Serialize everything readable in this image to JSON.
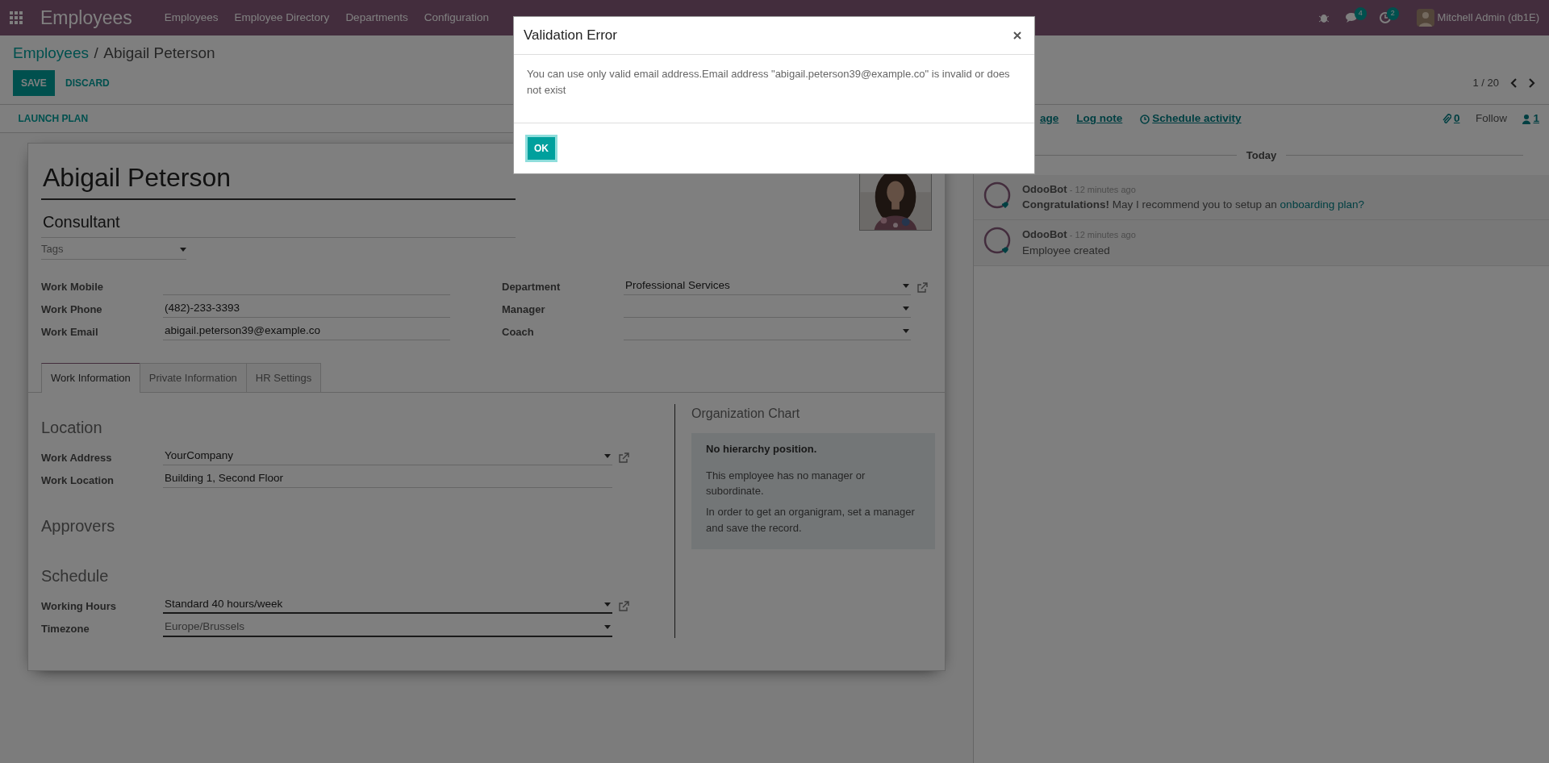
{
  "navbar": {
    "app_title": "Employees",
    "menu": [
      "Employees",
      "Employee Directory",
      "Departments",
      "Configuration"
    ],
    "messages_count": "4",
    "activities_count": "2",
    "user": "Mitchell Admin (db1E)"
  },
  "breadcrumb_separator": "/",
  "breadcrumb": [
    {
      "label": "Employees"
    },
    {
      "label": "Abigail Peterson"
    }
  ],
  "buttons": [
    {
      "label": "SAVE",
      "kind": "primary"
    },
    {
      "label": "DISCARD",
      "kind": "link"
    }
  ],
  "pager": "1 / 20",
  "status_buttons": [
    "LAUNCH PLAN"
  ],
  "form": {
    "name": "Abigail Peterson",
    "job_title": "Consultant",
    "tags_placeholder": "Tags",
    "groups": [
      [
        {
          "label": "Work Mobile",
          "kind": "text"
        },
        {
          "label": "Work Phone",
          "kind": "text",
          "value": "(482)-233-3393"
        },
        {
          "label": "Work Email",
          "kind": "text",
          "value": "abigail.peterson39@example.co"
        }
      ],
      [
        {
          "label": "Department",
          "kind": "many2one",
          "value": "Professional Services",
          "open_link": true
        },
        {
          "label": "Manager",
          "kind": "many2one",
          "open_link": false
        },
        {
          "label": "Coach",
          "kind": "many2one",
          "open_link": false
        }
      ]
    ],
    "tabs": [
      {
        "label": "Work Information",
        "selected": true
      },
      {
        "label": "Private Information",
        "selected": false
      },
      {
        "label": "HR Settings",
        "selected": false
      }
    ],
    "sections": [
      {
        "title": "Location",
        "fields": [
          {
            "label": "Work Address",
            "kind": "many2one",
            "value": "YourCompany",
            "open_link": true,
            "required": false
          },
          {
            "label": "Work Location",
            "kind": "text",
            "value": "Building 1, Second Floor",
            "required": false
          }
        ]
      },
      {
        "title": "Approvers"
      },
      {
        "title": "Schedule",
        "fields": [
          {
            "label": "Working Hours",
            "kind": "many2one",
            "value": "Standard 40 hours/week",
            "open_link": true,
            "required": true
          },
          {
            "label": "Timezone",
            "kind": "selection",
            "value": "Europe/Brussels",
            "required": true
          }
        ]
      }
    ],
    "org_chart": {
      "title": "Organization Chart",
      "heading": "No hierarchy position.",
      "paragraphs": [
        "This employee has no manager or subordinate.",
        "In order to get an organigram, set a manager and save the record."
      ]
    }
  },
  "chatter": {
    "actions": [
      {
        "label": "age",
        "kind": "send"
      },
      {
        "label": "Log note",
        "kind": "note"
      },
      {
        "label": "Schedule activity",
        "kind": "activity"
      }
    ],
    "attachments": "0",
    "follow": "Follow",
    "followers": "1",
    "date": "Today",
    "messages": [
      {
        "author": "OdooBot",
        "time": "- 12 minutes ago",
        "text": "**Congratulations!** May I recommend you to setup an ",
        "link": "onboarding plan?"
      },
      {
        "author": "OdooBot",
        "time": "- 12 minutes ago",
        "text": "Employee created"
      }
    ]
  },
  "dialog": {
    "title": "Validation Error",
    "body": "You can use only valid email address.Email address \"abigail.peterson39@example.co\" is invalid or does not exist",
    "button": "OK"
  }
}
